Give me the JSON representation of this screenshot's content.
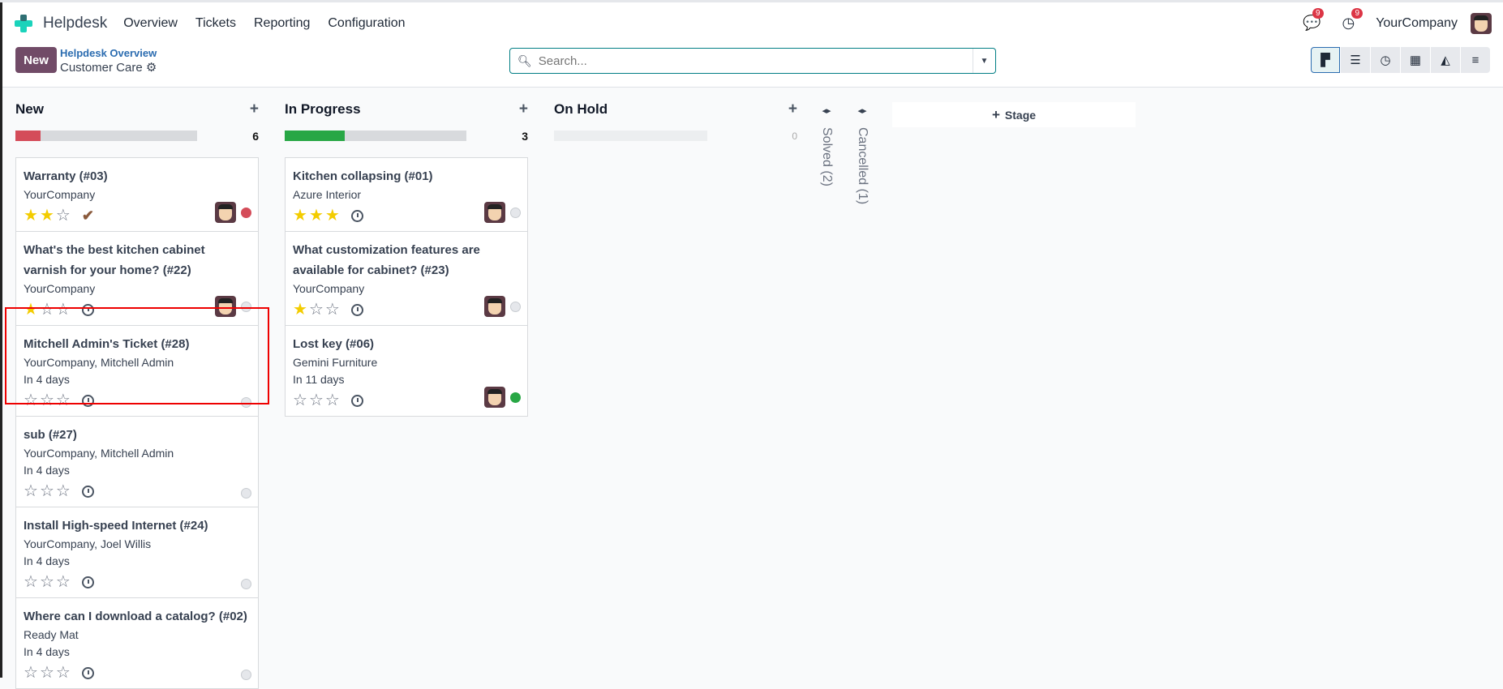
{
  "nav": {
    "app": "Helpdesk",
    "menu": [
      "Overview",
      "Tickets",
      "Reporting",
      "Configuration"
    ],
    "messages_badge": "9",
    "activities_badge": "9",
    "company": "YourCompany"
  },
  "control": {
    "new_label": "New",
    "breadcrumb_parent": "Helpdesk Overview",
    "breadcrumb_current": "Customer Care",
    "search_placeholder": "Search..."
  },
  "views": [
    "kanban",
    "list",
    "activity",
    "pivot",
    "graph",
    "cohort"
  ],
  "columns": [
    {
      "title": "New",
      "count": "6",
      "progress_pct": 14,
      "color": "#d44c59",
      "cards": [
        {
          "title": "Warranty (#03)",
          "lines": [
            "YourCompany"
          ],
          "stars": 2,
          "icon": "check",
          "avatar": true,
          "status": "red"
        },
        {
          "title": "What's the best kitchen cabinet varnish for your home? (#22)",
          "lines": [
            "YourCompany"
          ],
          "stars": 1,
          "icon": "clock",
          "avatar": true,
          "status": "grey"
        },
        {
          "title": "Mitchell Admin's Ticket (#28)",
          "lines": [
            "YourCompany, Mitchell Admin",
            "In 4 days"
          ],
          "stars": 0,
          "icon": "clock",
          "avatar": false,
          "status": "grey"
        },
        {
          "title": "sub (#27)",
          "lines": [
            "YourCompany, Mitchell Admin",
            "In 4 days"
          ],
          "stars": 0,
          "icon": "clock",
          "avatar": false,
          "status": "grey"
        },
        {
          "title": "Install High-speed Internet (#24)",
          "lines": [
            "YourCompany, Joel Willis",
            "In 4 days"
          ],
          "stars": 0,
          "icon": "clock",
          "avatar": false,
          "status": "grey"
        },
        {
          "title": "Where can I download a catalog? (#02)",
          "lines": [
            "Ready Mat",
            "In 4 days"
          ],
          "stars": 0,
          "icon": "clock",
          "avatar": false,
          "status": "grey"
        }
      ]
    },
    {
      "title": "In Progress",
      "count": "3",
      "progress_pct": 33,
      "color": "#28a745",
      "cards": [
        {
          "title": "Kitchen collapsing (#01)",
          "lines": [
            "Azure Interior"
          ],
          "stars": 3,
          "icon": "clock",
          "avatar": true,
          "status": "grey"
        },
        {
          "title": "What customization features are available for cabinet? (#23)",
          "lines": [
            "YourCompany"
          ],
          "stars": 1,
          "icon": "clock",
          "avatar": true,
          "status": "grey"
        },
        {
          "title": "Lost key (#06)",
          "lines": [
            "Gemini Furniture",
            "In 11 days"
          ],
          "stars": 0,
          "icon": "clock",
          "avatar": true,
          "status": "green"
        }
      ]
    },
    {
      "title": "On Hold",
      "count": "0",
      "progress_pct": 0,
      "color": "#d8dadd",
      "cards": []
    }
  ],
  "folded": [
    "Solved (2)",
    "Cancelled (1)"
  ],
  "add_stage": "Stage"
}
